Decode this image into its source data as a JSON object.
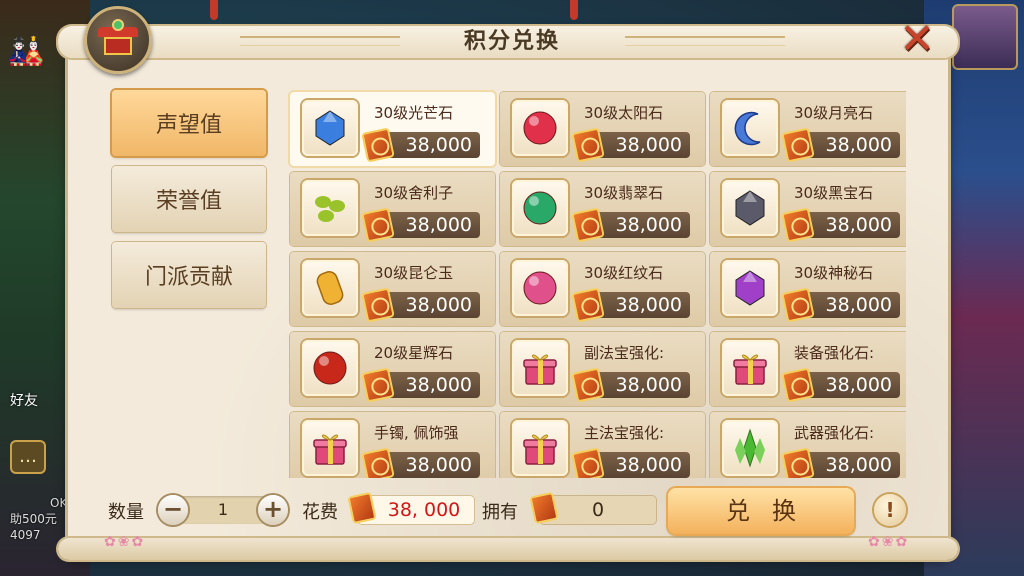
{
  "window": {
    "title": "积分兑换"
  },
  "sidebar_hud": {
    "friend_label": "好友",
    "lines": [
      "OK",
      "助500元",
      "4097"
    ]
  },
  "tabs": [
    {
      "label": "声望值",
      "active": true
    },
    {
      "label": "荣誉值",
      "active": false
    },
    {
      "label": "门派贡献",
      "active": false
    }
  ],
  "items": [
    {
      "name": "30级光芒石",
      "price": "38,000",
      "icon": "blue-crystal-gem",
      "color": "#3a7fe0"
    },
    {
      "name": "30级太阳石",
      "price": "38,000",
      "icon": "red-swirl-orb",
      "color": "#e0304a"
    },
    {
      "name": "30级月亮石",
      "price": "38,000",
      "icon": "blue-crescent-moon",
      "color": "#4a7ad8"
    },
    {
      "name": "30级舍利子",
      "price": "38,000",
      "icon": "green-beads",
      "color": "#9ac22a"
    },
    {
      "name": "30级翡翠石",
      "price": "38,000",
      "icon": "jade-orb",
      "color": "#2aa868"
    },
    {
      "name": "30级黑宝石",
      "price": "38,000",
      "icon": "black-diamond-gem",
      "color": "#5a5a6a"
    },
    {
      "name": "30级昆仑玉",
      "price": "38,000",
      "icon": "golden-jade-tablet",
      "color": "#f0b232"
    },
    {
      "name": "30级红纹石",
      "price": "38,000",
      "icon": "pink-spiral-stone",
      "color": "#e0508a"
    },
    {
      "name": "30级神秘石",
      "price": "38,000",
      "icon": "purple-crystal",
      "color": "#a040c8"
    },
    {
      "name": "20级星辉石",
      "price": "38,000",
      "icon": "red-star-orb",
      "color": "#c8281a"
    },
    {
      "name": "副法宝强化:",
      "price": "38,000",
      "icon": "gift-box",
      "color": "#e04a7a"
    },
    {
      "name": "装备强化石:",
      "price": "38,000",
      "icon": "gift-box",
      "color": "#e04a7a"
    },
    {
      "name": "手镯, 佩饰强",
      "price": "38,000",
      "icon": "gift-box",
      "color": "#e04a7a"
    },
    {
      "name": "主法宝强化:",
      "price": "38,000",
      "icon": "gift-box",
      "color": "#e04a7a"
    },
    {
      "name": "武器强化石:",
      "price": "38,000",
      "icon": "green-crystal-cluster",
      "color": "#4ab832"
    }
  ],
  "footer": {
    "quantity_label": "数量",
    "quantity_value": "1",
    "minus": "−",
    "plus": "+",
    "cost_label": "花费",
    "cost_value": "38, 000",
    "own_label": "拥有",
    "own_value": "0",
    "exchange_label": "兑换",
    "help": "!"
  },
  "close_glyph": "✕"
}
